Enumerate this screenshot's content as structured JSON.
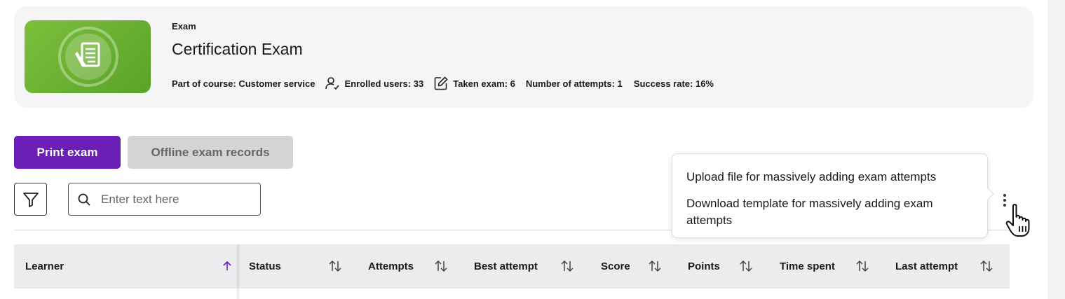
{
  "header": {
    "kind_label": "Exam",
    "title": "Certification Exam",
    "thumbnail_icon": "exam-document-icon",
    "thumbnail_color": "#6ab02f",
    "meta": {
      "course": "Part of course: Customer service",
      "enrolled": "Enrolled users: 33",
      "taken": "Taken exam: 6",
      "attempts": "Number of attempts: 1",
      "success": "Success rate: 16%"
    }
  },
  "actions": {
    "print_label": "Print exam",
    "offline_label": "Offline exam records",
    "accent": "#6c1fb8"
  },
  "search": {
    "placeholder": "Enter text here",
    "value": ""
  },
  "menu": {
    "items": [
      "Upload file for massively adding exam attempts",
      "Download template for massively adding exam attempts"
    ]
  },
  "table": {
    "columns": [
      {
        "label": "Learner",
        "sort": "ascending"
      },
      {
        "label": "Status",
        "sort": "none"
      },
      {
        "label": "Attempts",
        "sort": "none"
      },
      {
        "label": "Best attempt",
        "sort": "none"
      },
      {
        "label": "Score",
        "sort": "none"
      },
      {
        "label": "Points",
        "sort": "none"
      },
      {
        "label": "Time spent",
        "sort": "none"
      },
      {
        "label": "Last attempt",
        "sort": "none"
      }
    ]
  }
}
